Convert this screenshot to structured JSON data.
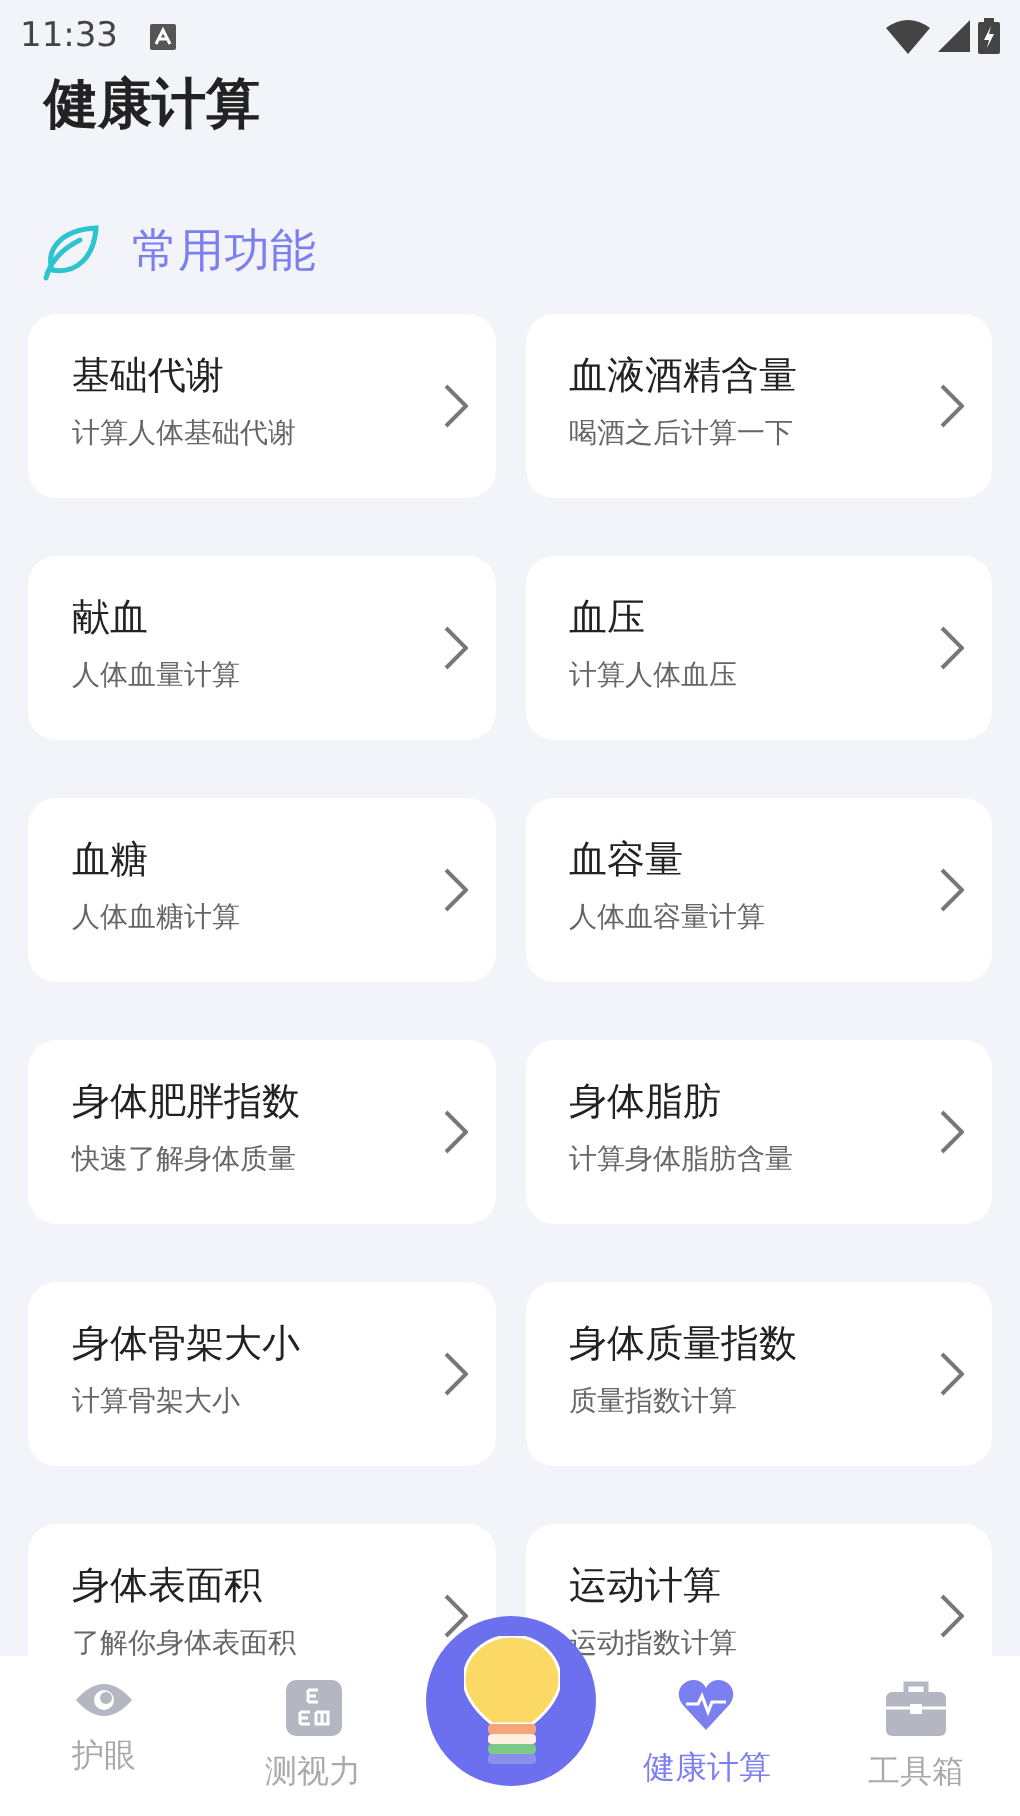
{
  "status_bar": {
    "time": "11:33"
  },
  "page_title": "健康计算",
  "section": {
    "title": "常用功能"
  },
  "tools": [
    {
      "title": "基础代谢",
      "subtitle": "计算人体基础代谢"
    },
    {
      "title": "血液酒精含量",
      "subtitle": "喝酒之后计算一下"
    },
    {
      "title": "献血",
      "subtitle": "人体血量计算"
    },
    {
      "title": "血压",
      "subtitle": "计算人体血压"
    },
    {
      "title": "血糖",
      "subtitle": "人体血糖计算"
    },
    {
      "title": "血容量",
      "subtitle": "人体血容量计算"
    },
    {
      "title": "身体肥胖指数",
      "subtitle": "快速了解身体质量"
    },
    {
      "title": "身体脂肪",
      "subtitle": "计算身体脂肪含量"
    },
    {
      "title": "身体骨架大小",
      "subtitle": "计算骨架大小"
    },
    {
      "title": "身体质量指数",
      "subtitle": "质量指数计算"
    },
    {
      "title": "身体表面积",
      "subtitle": "了解你身体表面积"
    },
    {
      "title": "运动计算",
      "subtitle": "运动指数计算"
    }
  ],
  "bottom_nav": [
    {
      "kind": "eye",
      "label": "护眼",
      "selected": false
    },
    {
      "kind": "chart",
      "label": "测视力",
      "selected": false
    },
    {
      "kind": "center"
    },
    {
      "kind": "heart",
      "label": "健康计算",
      "selected": true
    },
    {
      "kind": "toolbox",
      "label": "工具箱",
      "selected": false
    }
  ]
}
